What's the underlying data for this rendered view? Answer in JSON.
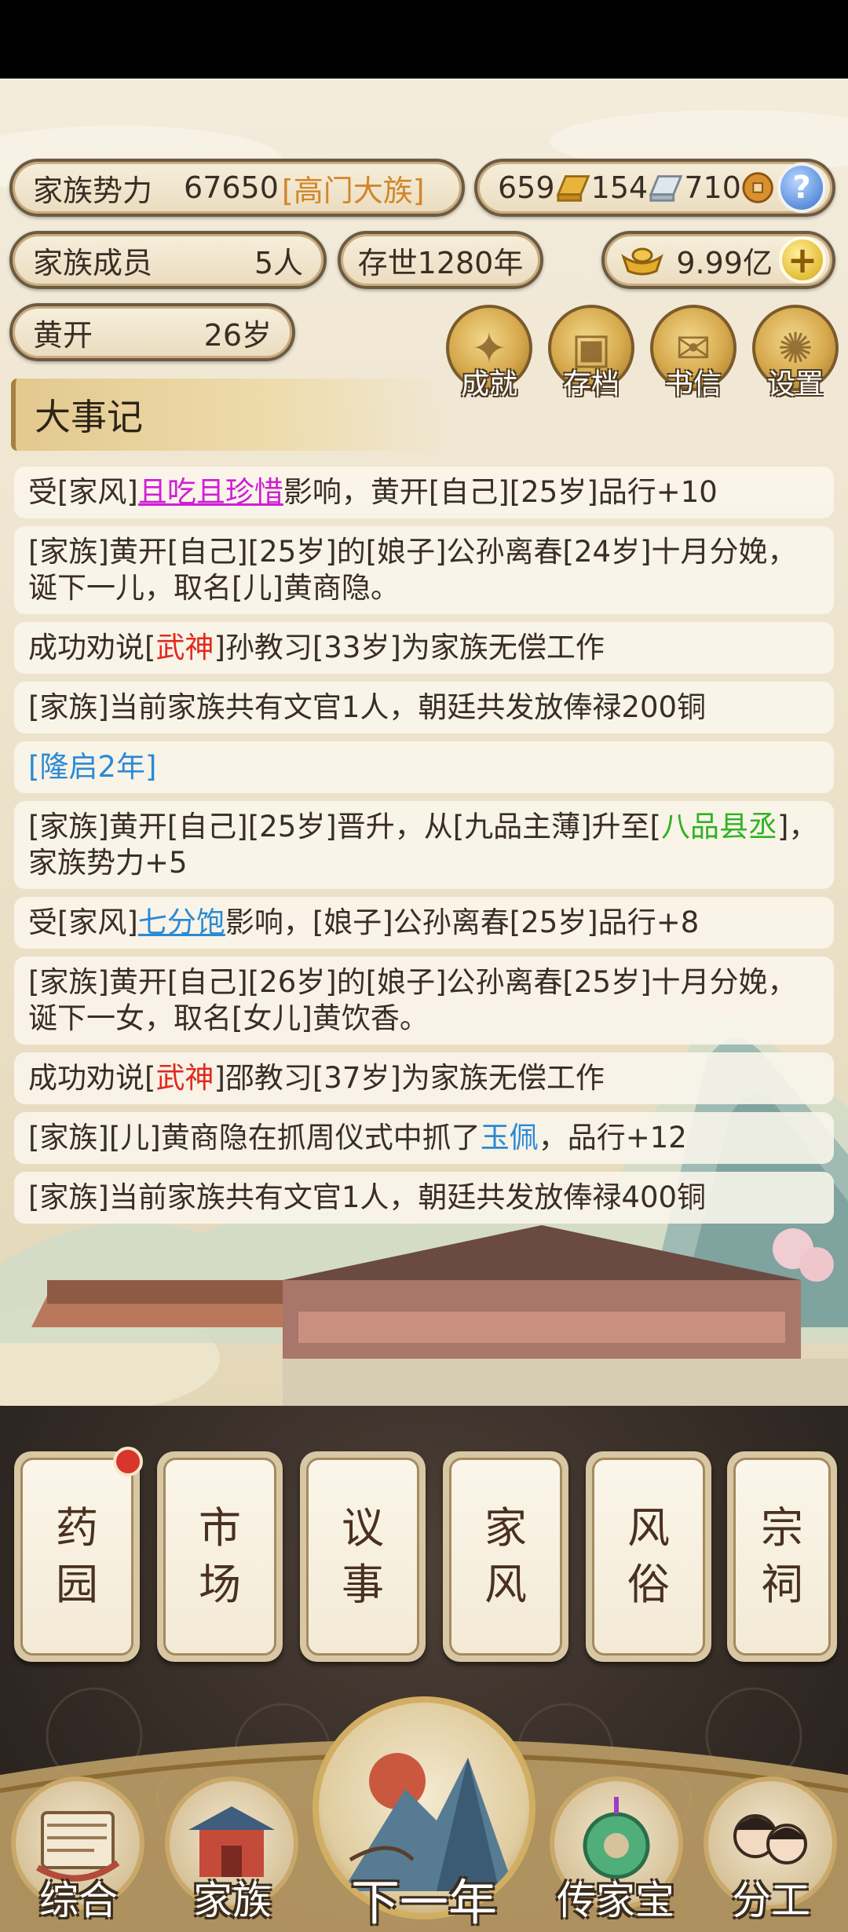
{
  "header": {
    "power_label": "家族势力",
    "power_value": "67650",
    "power_rank": "[高门大族]",
    "gold_count": "659",
    "silver_count": "154",
    "copper_count": "710",
    "members_label": "家族成员",
    "members_value": "5人",
    "years_label": "存世1280年",
    "ingot_value": "9.99亿",
    "char_name": "黄开",
    "char_age": "26岁"
  },
  "quick_buttons": [
    {
      "label": "成就",
      "icon": "achievement-icon"
    },
    {
      "label": "存档",
      "icon": "save-icon"
    },
    {
      "label": "书信",
      "icon": "letter-icon"
    },
    {
      "label": "设置",
      "icon": "settings-icon"
    }
  ],
  "chronicle_title": "大事记",
  "events": {
    "e0": {
      "a": "受[家风]",
      "b": "且吃且珍惜",
      "c": "影响，黄开[自己][25岁]品行+10"
    },
    "e1": {
      "a": "[家族]黄开[自己][25岁]的[娘子]公孙离春[24岁]十月分娩，诞下一儿，取名[儿]黄商隐。"
    },
    "e2": {
      "a": "成功劝说[",
      "b": "武神",
      "c": "]孙教习[33岁]为家族无偿工作"
    },
    "e3": {
      "a": "[家族]当前家族共有文官1人，朝廷共发放俸禄200铜"
    },
    "e4": {
      "a": "[隆启2年]"
    },
    "e5": {
      "a": "[家族]黄开[自己][25岁]晋升，从[九品主薄]升至[",
      "b": "八品县丞",
      "c": "]，家族势力+5"
    },
    "e6": {
      "a": "受[家风]",
      "b": "七分饱",
      "c": "影响，[娘子]公孙离春[25岁]品行+8"
    },
    "e7": {
      "a": "[家族]黄开[自己][26岁]的[娘子]公孙离春[25岁]十月分娩，诞下一女，取名[女儿]黄饮香。"
    },
    "e8": {
      "a": "成功劝说[",
      "b": "武神",
      "c": "]邵教习[37岁]为家族无偿工作"
    },
    "e9": {
      "a": "[家族][儿]黄商隐在抓周仪式中抓了",
      "b": "玉佩",
      "c": "，品行+12"
    },
    "e10": {
      "a": "[家族]当前家族共有文官1人，朝廷共发放俸禄400铜"
    }
  },
  "features": [
    {
      "top": "药",
      "bottom": "园"
    },
    {
      "top": "市",
      "bottom": "场"
    },
    {
      "top": "议",
      "bottom": "事"
    },
    {
      "top": "家",
      "bottom": "风"
    },
    {
      "top": "风",
      "bottom": "俗"
    },
    {
      "top": "宗",
      "bottom": "祠"
    }
  ],
  "nav": {
    "general": "综合",
    "family": "家族",
    "next_year": "下一年",
    "heirloom": "传家宝",
    "division": "分工"
  },
  "colors": {
    "highlight_pink": "#d11dd6",
    "highlight_red": "#e02a1e",
    "highlight_green": "#2fb224",
    "highlight_blue": "#2a8ad6",
    "rank_gold": "#d2862a"
  }
}
